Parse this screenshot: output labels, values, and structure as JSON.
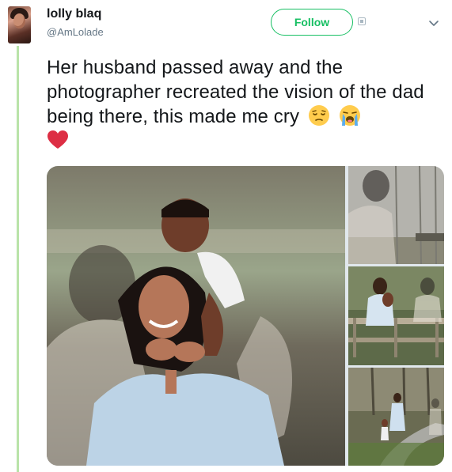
{
  "tweet": {
    "author_name": "lolly blaq",
    "author_handle": "@AmLolade",
    "follow_label": "Follow",
    "text": "Her husband passed away and the photographer recreated the vision of the dad being there, this made me cry",
    "emojis": [
      "pensive-face-emoji",
      "loudly-crying-face-emoji",
      "red-heart-emoji"
    ]
  },
  "colors": {
    "accent": "#17bf63",
    "thread_line": "#b9e3a9",
    "secondary_text": "#657786"
  },
  "media": {
    "photos": [
      "main-family-photo",
      "father-ghost-photo",
      "bridge-photo",
      "path-walk-photo"
    ]
  }
}
